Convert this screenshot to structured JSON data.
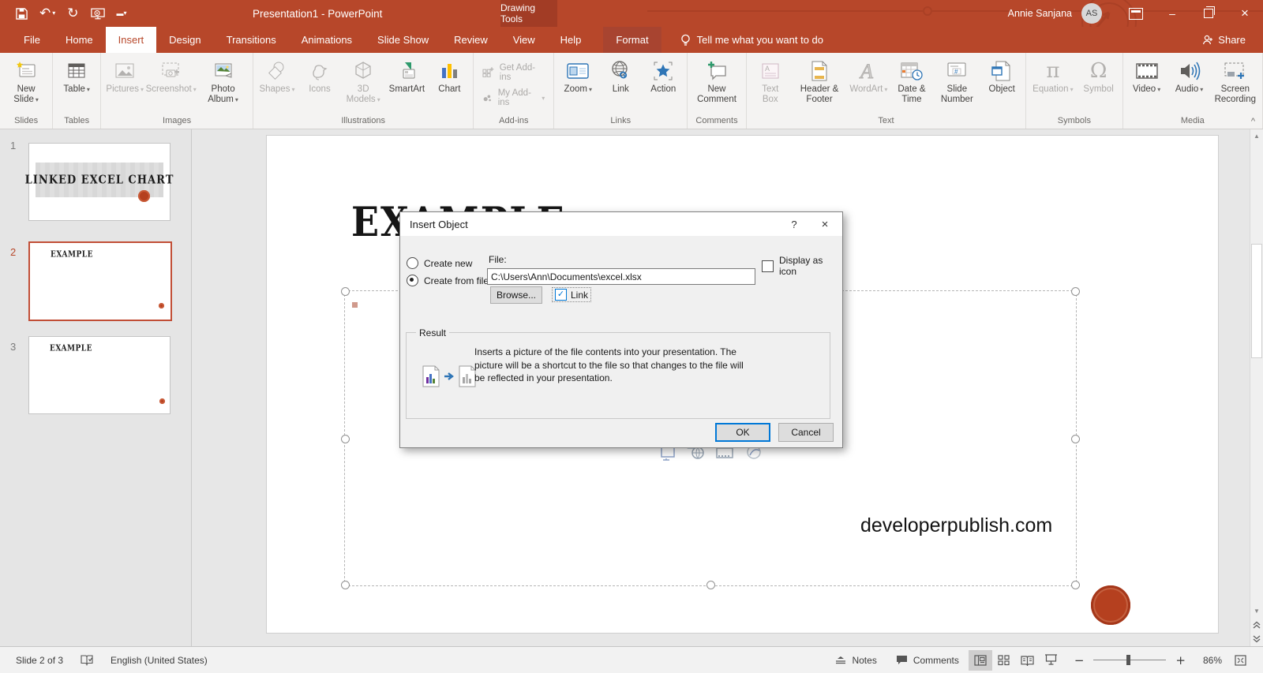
{
  "icons": {
    "caret": "▾",
    "undo": "↶",
    "redo": "↻",
    "minimize": "–",
    "close": "×",
    "dialog_help": "?",
    "dialog_close": "×",
    "pi": "π",
    "omega": "Ω",
    "action_star": "★",
    "zoom_minus": "−",
    "zoom_plus": "+",
    "scroll_up": "▲",
    "scroll_down": "▼",
    "collapse": "^"
  },
  "titlebar": {
    "title": "Presentation1 - PowerPoint",
    "contextual_tools": "Drawing Tools",
    "user_name": "Annie Sanjana",
    "user_initials": "AS"
  },
  "tabs": {
    "items": [
      "File",
      "Home",
      "Insert",
      "Design",
      "Transitions",
      "Animations",
      "Slide Show",
      "Review",
      "View",
      "Help"
    ],
    "active": "Insert",
    "contextual": "Format",
    "tell_me": "Tell me what you want to do",
    "share": "Share"
  },
  "ribbon": {
    "groups": [
      {
        "label": "Slides",
        "buttons": [
          {
            "label": "New Slide"
          }
        ]
      },
      {
        "label": "Tables",
        "buttons": [
          {
            "label": "Table"
          }
        ]
      },
      {
        "label": "Images",
        "buttons": [
          {
            "label": "Pictures"
          },
          {
            "label": "Screenshot"
          },
          {
            "label": "Photo Album"
          }
        ]
      },
      {
        "label": "Illustrations",
        "buttons": [
          {
            "label": "Shapes"
          },
          {
            "label": "Icons"
          },
          {
            "label": "3D Models"
          },
          {
            "label": "SmartArt"
          },
          {
            "label": "Chart"
          }
        ]
      },
      {
        "label": "Add-ins",
        "buttons": [
          {
            "label": "Get Add-ins"
          },
          {
            "label": "My Add-ins"
          }
        ]
      },
      {
        "label": "Links",
        "buttons": [
          {
            "label": "Zoom"
          },
          {
            "label": "Link"
          },
          {
            "label": "Action"
          }
        ]
      },
      {
        "label": "Comments",
        "buttons": [
          {
            "label": "New Comment"
          }
        ]
      },
      {
        "label": "Text",
        "buttons": [
          {
            "label": "Text Box"
          },
          {
            "label": "Header & Footer"
          },
          {
            "label": "WordArt"
          },
          {
            "label": "Date & Time"
          },
          {
            "label": "Slide Number"
          },
          {
            "label": "Object"
          }
        ]
      },
      {
        "label": "Symbols",
        "buttons": [
          {
            "label": "Equation"
          },
          {
            "label": "Symbol"
          }
        ]
      },
      {
        "label": "Media",
        "buttons": [
          {
            "label": "Video"
          },
          {
            "label": "Audio"
          },
          {
            "label": "Screen Recording"
          }
        ]
      }
    ]
  },
  "thumbnails": {
    "slides": [
      {
        "number": "1",
        "title": "LINKED EXCEL CHART"
      },
      {
        "number": "2",
        "title": "EXAMPLE"
      },
      {
        "number": "3",
        "title": "EXAMPLE"
      }
    ]
  },
  "canvas": {
    "title": "EXAMPLE",
    "watermark": "developerpublish.com"
  },
  "dialog": {
    "title": "Insert Object",
    "radio_create_new": "Create new",
    "radio_create_from_file": "Create from file",
    "file_label": "File:",
    "file_value": "C:\\Users\\Ann\\Documents\\excel.xlsx",
    "browse_label": "Browse...",
    "link_label": "Link",
    "display_as_icon_label": "Display as icon",
    "result_label": "Result",
    "result_text": "Inserts a picture of the file contents into your presentation. The picture will be a shortcut to the file so that changes to the file will be reflected in your presentation.",
    "ok_label": "OK",
    "cancel_label": "Cancel"
  },
  "statusbar": {
    "slide_indicator": "Slide 2 of 3",
    "language": "English (United States)",
    "notes": "Notes",
    "comments": "Comments",
    "zoom_level": "86%"
  }
}
